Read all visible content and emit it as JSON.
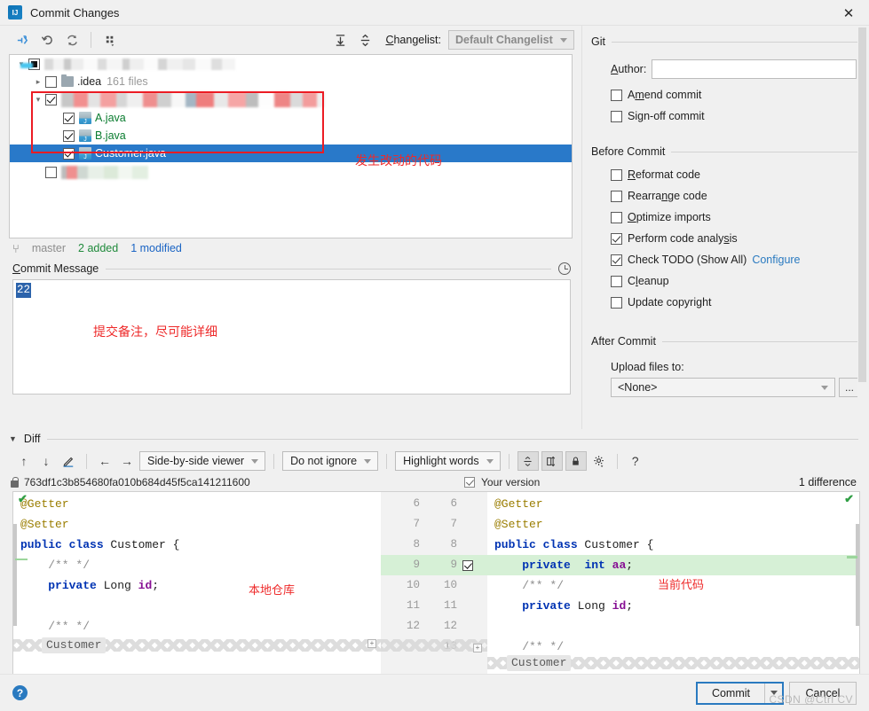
{
  "window": {
    "title": "Commit Changes",
    "app_icon": "intellij-idea-logo",
    "close_icon": "✕"
  },
  "changes_toolbar": {
    "icons": [
      {
        "name": "show-diff-icon",
        "glyph": "↯"
      },
      {
        "name": "rollback-icon",
        "glyph": "↺"
      },
      {
        "name": "refresh-icon",
        "glyph": "⟳"
      },
      {
        "name": "group-by-icon",
        "glyph": "⠿"
      }
    ],
    "expand_all_icon": "⤓",
    "collapse_all_icon": "⤒",
    "changelist_label": "Changelist:",
    "changelist_value": "Default Changelist"
  },
  "tree": {
    "rows": [
      {
        "name": "project-root",
        "label": "",
        "redacted": true,
        "checkbox": "partial",
        "twisty": "▾"
      },
      {
        "name": "idea-folder",
        "label": ".idea",
        "suffix": "161 files",
        "checkbox": "unchecked",
        "twisty": "▸"
      },
      {
        "name": "module-folder",
        "label": "",
        "redacted": true,
        "checkbox": "checked",
        "twisty": "▾"
      },
      {
        "name": "file-a-java",
        "label": "A.java",
        "checkbox": "checked"
      },
      {
        "name": "file-b-java",
        "label": "B.java",
        "checkbox": "checked"
      },
      {
        "name": "file-customer-java",
        "label": "Customer.java",
        "checkbox": "checked",
        "selected": true
      },
      {
        "name": "other-folder",
        "label": "",
        "redacted": true,
        "checkbox": "unchecked"
      }
    ],
    "annotation": "发生改动的代码"
  },
  "status": {
    "branch_icon": "branch-icon",
    "branch": "master",
    "added": "2 added",
    "modified": "1 modified"
  },
  "commit_message": {
    "label": "Commit Message",
    "history_icon": "clock-history-icon",
    "value": "22",
    "annotation": "提交备注，尽可能详细"
  },
  "git_panel": {
    "group_title": "Git",
    "author_label": "Author:",
    "author_value": "",
    "options": [
      {
        "name": "amend-commit",
        "label": "Amend commit",
        "checked": false
      },
      {
        "name": "sign-off-commit",
        "label": "Sign-off commit",
        "checked": false
      }
    ]
  },
  "before_commit": {
    "group_title": "Before Commit",
    "options": [
      {
        "name": "reformat-code",
        "label": "Reformat code",
        "checked": false
      },
      {
        "name": "rearrange-code",
        "label": "Rearrange code",
        "checked": false
      },
      {
        "name": "optimize-imports",
        "label": "Optimize imports",
        "checked": false
      },
      {
        "name": "perform-code-analysis",
        "label": "Perform code analysis",
        "checked": true
      },
      {
        "name": "check-todo",
        "label": "Check TODO (Show All)",
        "checked": true,
        "link": "Configure"
      },
      {
        "name": "cleanup",
        "label": "Cleanup",
        "checked": false
      },
      {
        "name": "update-copyright",
        "label": "Update copyright",
        "checked": false
      }
    ]
  },
  "after_commit": {
    "group_title": "After Commit",
    "upload_label": "Upload files to:",
    "upload_value": "<None>",
    "browse_label": "..."
  },
  "diff": {
    "section_title": "Diff",
    "toolbar": {
      "prev_diff_icon": "↑",
      "next_diff_icon": "↓",
      "edit_icon": "✎",
      "apply_left_icon": "←",
      "apply_right_icon": "→",
      "viewer_mode": "Side-by-side viewer",
      "whitespace_mode": "Do not ignore",
      "highlight_mode": "Highlight words",
      "collapse_icon": "⤒",
      "editor-size-icon": "◫",
      "lock_icon": "🔒",
      "settings_icon": "⚙",
      "help_icon": "?"
    },
    "left_title": "763df1c3b854680fa010b684d45f5ca141211600",
    "left_lock_icon": "lock-icon",
    "right_title": "Your version",
    "difference_count": "1 difference",
    "left_annotation": "本地仓库",
    "right_annotation": "当前代码",
    "left_lines": [
      {
        "num": "6",
        "code": "@Getter",
        "style": "ann"
      },
      {
        "num": "7",
        "code": "@Setter",
        "style": "ann"
      },
      {
        "num": "8",
        "code": "public class Customer {",
        "style": "decl"
      },
      {
        "num": "9",
        "code": "    /** */",
        "style": "cmt"
      },
      {
        "num": "10",
        "code": "    private Long id;",
        "style": "fielddecl"
      },
      {
        "num": "11",
        "code": "",
        "style": "plain"
      },
      {
        "num": "12",
        "code": "    /** */",
        "style": "cmt"
      }
    ],
    "left_fold_label": "Customer",
    "right_lines": [
      {
        "numL": "6",
        "numR": "6",
        "code": "@Getter",
        "style": "ann"
      },
      {
        "numL": "7",
        "numR": "7",
        "code": "@Setter",
        "style": "ann"
      },
      {
        "numL": "8",
        "numR": "8",
        "code": "public class Customer {",
        "style": "decl"
      },
      {
        "numL": "9",
        "numR": "9",
        "code": "    private  int aa;",
        "style": "added",
        "added": true
      },
      {
        "numL": "10",
        "numR": "10",
        "code": "    /** */",
        "style": "cmt"
      },
      {
        "numL": "11",
        "numR": "11",
        "code": "    private Long id;",
        "style": "fielddecl"
      },
      {
        "numL": "12",
        "numR": "12",
        "code": "",
        "style": "plain"
      },
      {
        "numL": "",
        "numR": "13",
        "code": "    /** */",
        "style": "cmt"
      }
    ],
    "right_fold_label": "Customer"
  },
  "footer": {
    "help_icon": "?",
    "commit_label": "Commit",
    "commit_dropdown_icon": "▾",
    "cancel_label": "Cancel",
    "watermark": "CSDN @Ctrl CV"
  }
}
